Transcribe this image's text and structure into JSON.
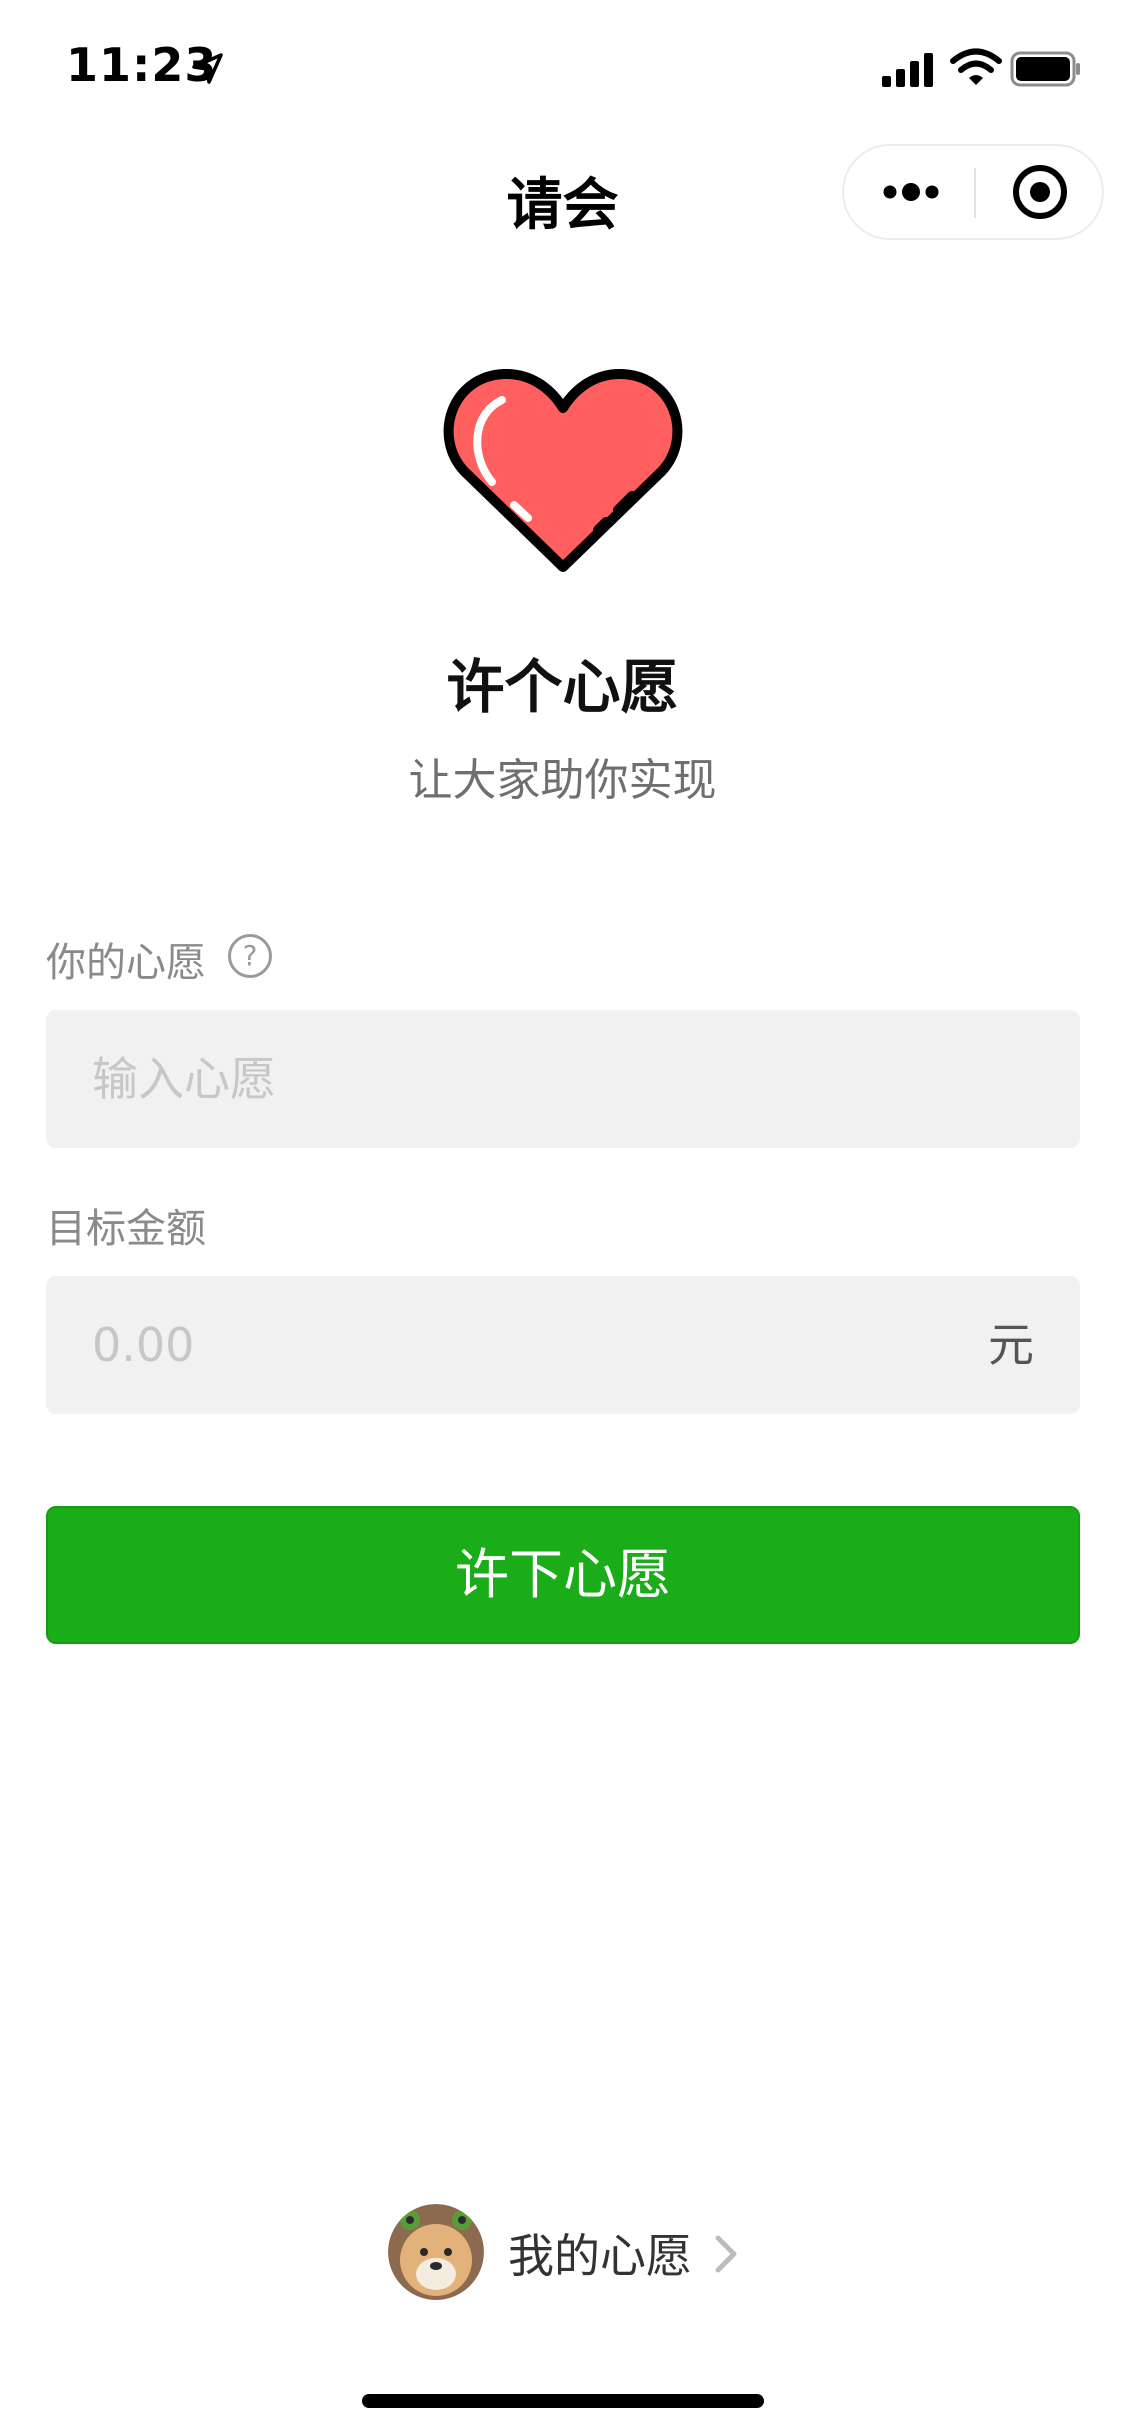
{
  "status_bar": {
    "time": "11:23"
  },
  "nav": {
    "title": "请会"
  },
  "hero": {
    "title": "许个心愿",
    "subtitle": "让大家助你实现"
  },
  "form": {
    "wish_label": "你的心愿",
    "help_glyph": "?",
    "wish_placeholder": "输入心愿",
    "amount_label": "目标金额",
    "amount_placeholder": "0.00",
    "amount_unit": "元"
  },
  "submit": {
    "label": "许下心愿"
  },
  "footer": {
    "my_wish_label": "我的心愿"
  },
  "colors": {
    "accent": "#1aad19",
    "heart": "#ff5f5f",
    "input_bg": "#f1f1f1"
  },
  "icons": [
    "location-arrow-icon",
    "signal-icon",
    "wifi-icon",
    "battery-icon",
    "more-icon",
    "close-target-icon",
    "heart-icon",
    "help-icon",
    "chevron-right-icon"
  ]
}
